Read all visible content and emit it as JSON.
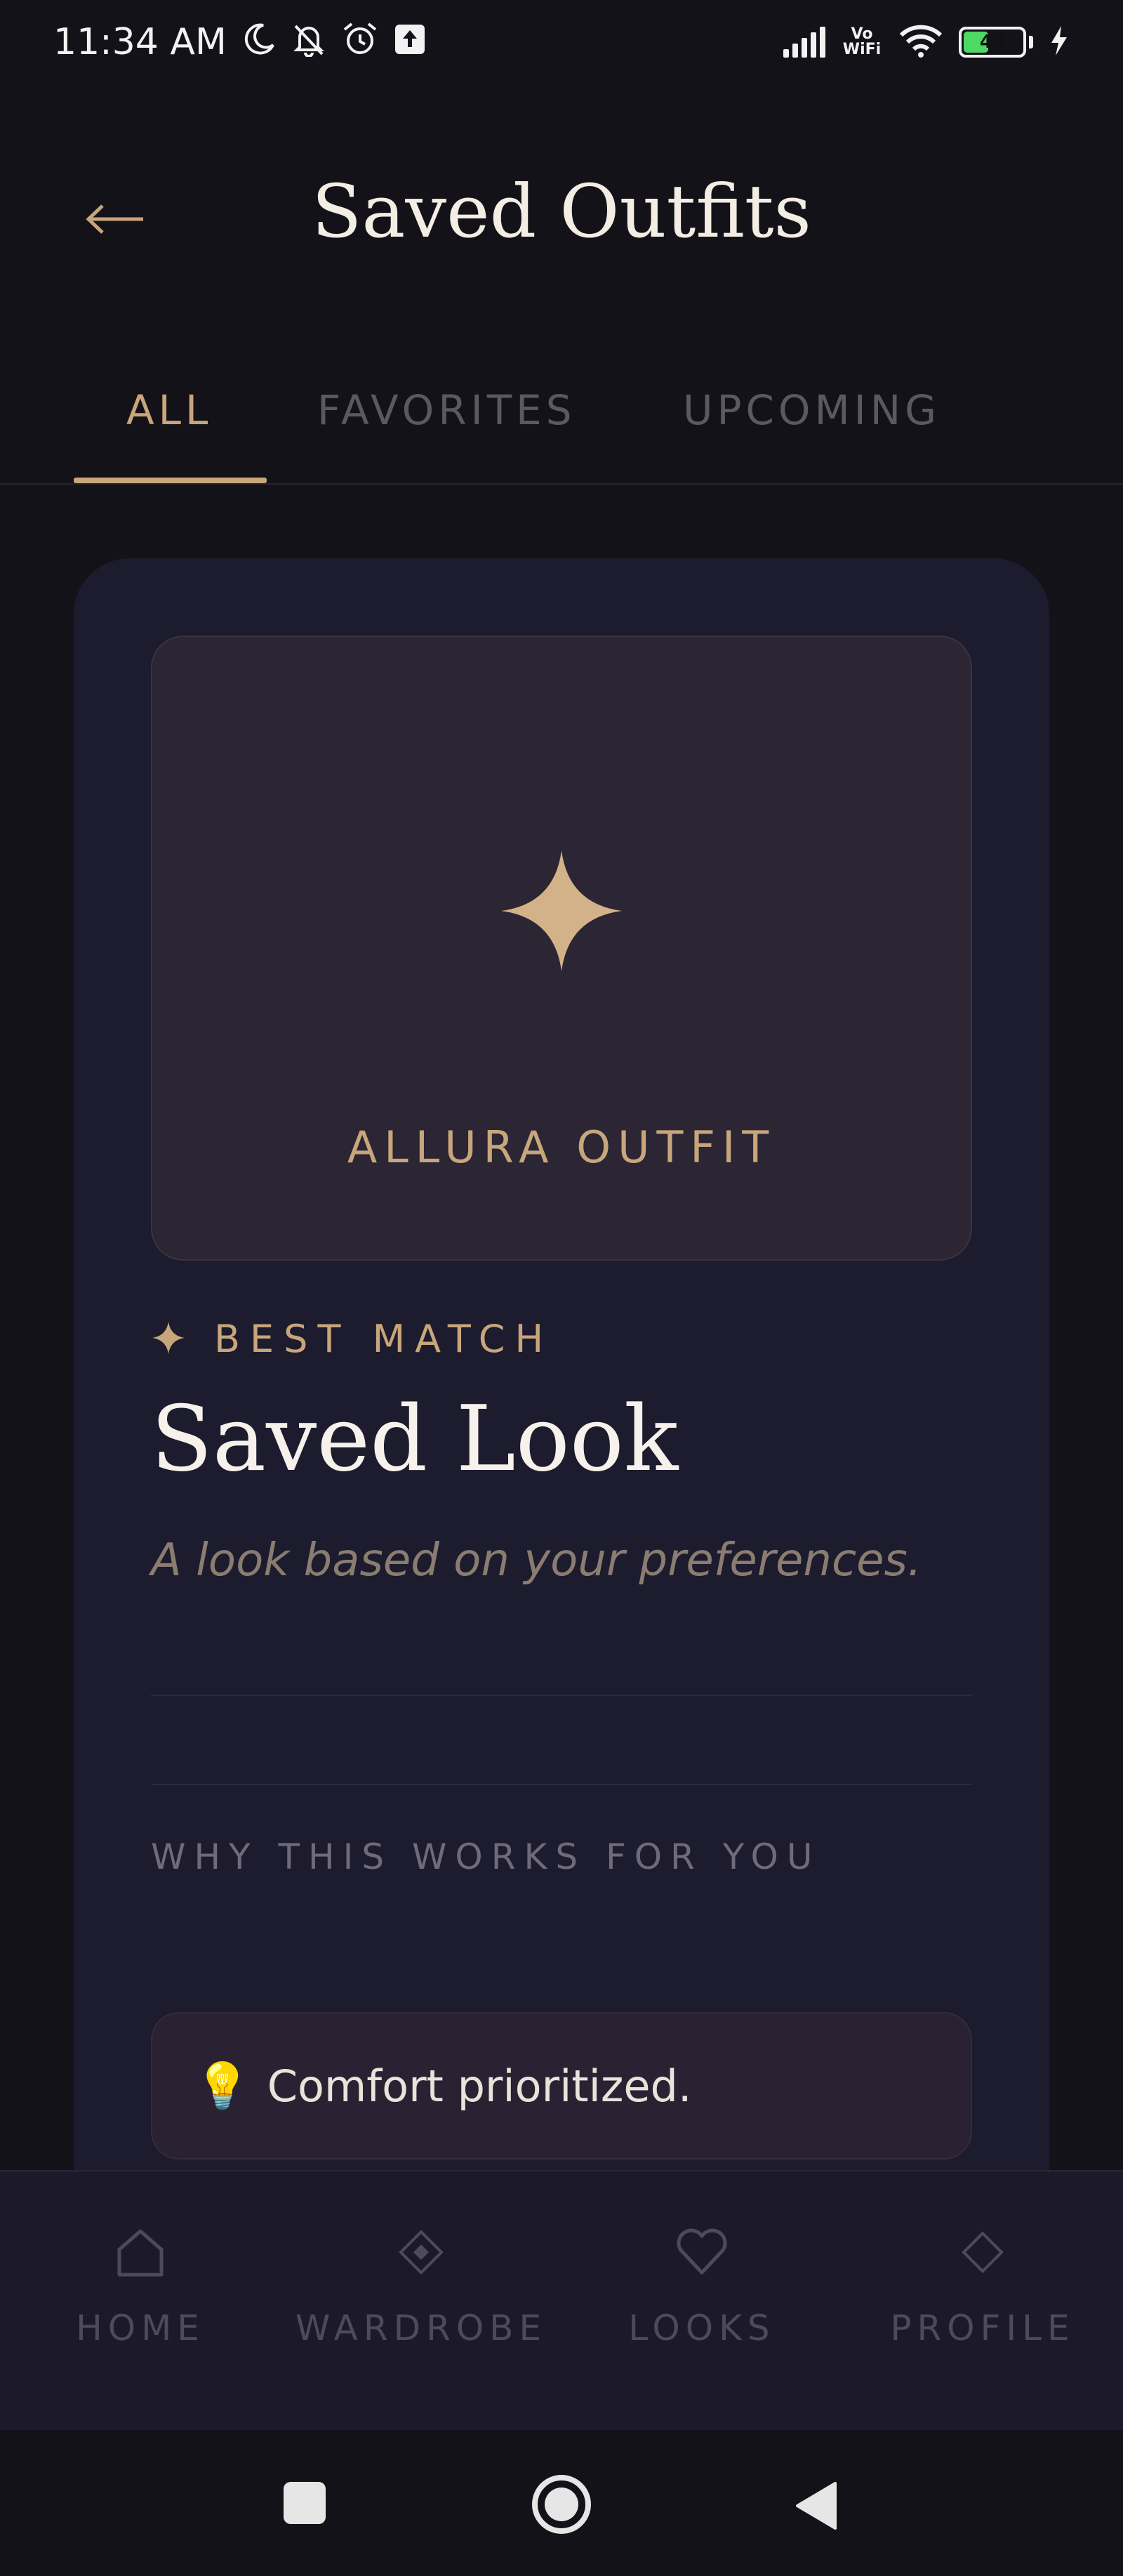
{
  "status_bar": {
    "time": "11:34 AM",
    "battery": "43",
    "network": "Vo WiFi"
  },
  "header": {
    "title": "Saved Outfits",
    "back_icon": "back-arrow-icon"
  },
  "tabs": [
    {
      "label": "ALL",
      "active": true
    },
    {
      "label": "FAVORITES",
      "active": false
    },
    {
      "label": "UPCOMING",
      "active": false
    }
  ],
  "outfit_card": {
    "image_label": "ALLURA OUTFIT",
    "badge": "BEST MATCH",
    "title": "Saved Look",
    "subtitle": "A look based on your preferences.",
    "why_heading": "WHY THIS WORKS FOR YOU",
    "reasons": [
      {
        "emoji": "💡",
        "text": "Comfort prioritized."
      }
    ]
  },
  "bottom_nav": [
    {
      "label": "HOME",
      "icon": "home-icon"
    },
    {
      "label": "WARDROBE",
      "icon": "wardrobe-icon"
    },
    {
      "label": "LOOKS",
      "icon": "heart-icon"
    },
    {
      "label": "PROFILE",
      "icon": "diamond-icon"
    }
  ],
  "colors": {
    "accent": "#c8a67b",
    "background": "#141219",
    "card": "#1d1b2e"
  }
}
